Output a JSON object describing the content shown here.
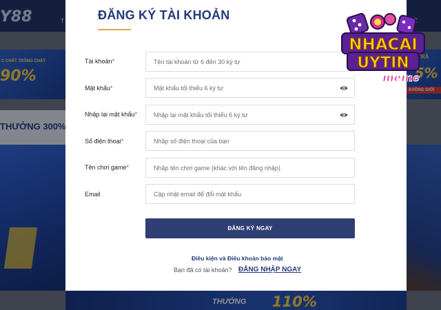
{
  "background": {
    "logo_text": "Y88",
    "nav_left": "T",
    "nav_right": "ĐỀ",
    "promo_left_small": "C CHẤT TRẮNG CHẤT",
    "promo_left_big": "90%",
    "promo_right_top": "TRẢ",
    "promo_right_pct": ",5%",
    "promo_right_sub": "KHÔNG GIỚI",
    "strip_text": "THƯỞNG 300%",
    "bottom_thuong": "THƯỞNG",
    "bottom_pct": "110%"
  },
  "modal": {
    "title": "ĐĂNG KÝ TÀI KHOẢN",
    "fields": [
      {
        "label": "Tài khoản",
        "required": "*",
        "placeholder": "Tên tài khoản từ 6 đến 30 ký tự",
        "eye": false
      },
      {
        "label": "Mật khẩu",
        "required": "*",
        "placeholder": "Mật khẩu tối thiểu 6 ký tự",
        "eye": true
      },
      {
        "label": "Nhập lại mật khẩu",
        "required": "*",
        "placeholder": "Nhập lại mật khẩu tối thiểu 6 ký tự",
        "eye": true
      },
      {
        "label": "Số điện thoại",
        "required": "*",
        "placeholder": "Nhập số điện thoại của bạn",
        "eye": false
      },
      {
        "label": "Tên chơi game",
        "required": "*",
        "placeholder": "Nhập tên chơi game (khác với tên đăng nhập)",
        "eye": false
      },
      {
        "label": "Email",
        "required": "",
        "placeholder": "Cập nhật email để đổi mật khẩu",
        "eye": false
      }
    ],
    "submit_label": "ĐĂNG KÝ NGAY",
    "terms_link": "Điều kiện và Điều khoản bảo mật",
    "login_question": "Bạn đã có tài khoản?",
    "login_link": "ĐĂNG NHẬP NGAY"
  },
  "watermark": {
    "line1": "NHACAI",
    "line2": "UYTIN",
    "line3": "meme"
  },
  "colors": {
    "title": "#233a7a",
    "underline": "#d9a24a",
    "required": "#e0322e",
    "button": "#2f3f73",
    "field_border": "#d9dce2",
    "watermark_fill": "#ffcc1a",
    "watermark_accent": "#7b2cbf"
  },
  "icons": {
    "password_toggle": "eye-icon"
  }
}
